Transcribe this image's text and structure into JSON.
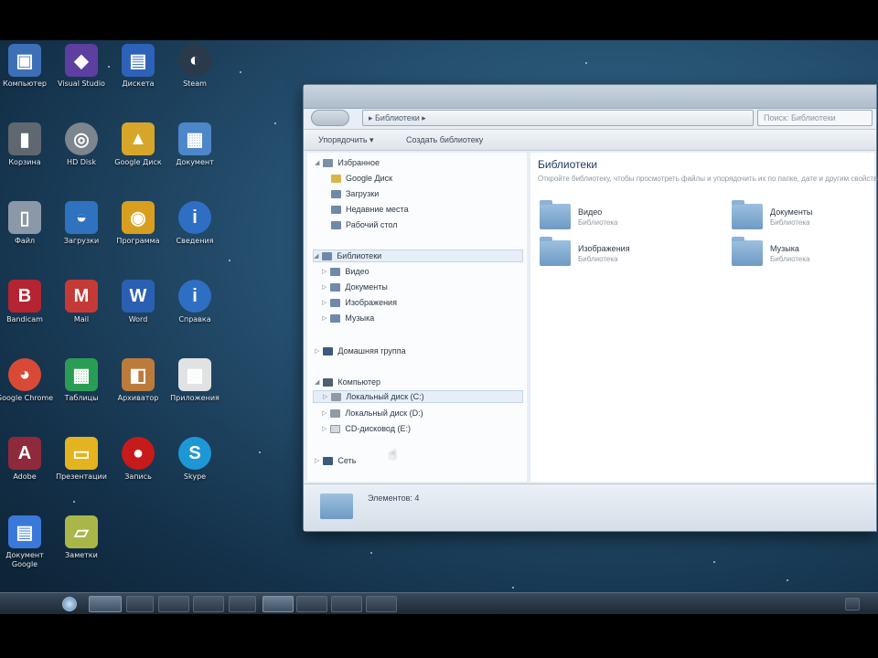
{
  "desktop": {
    "icons": [
      {
        "label": "Компьютер",
        "glyph": "▣",
        "color": "#3d6fb6"
      },
      {
        "label": "Visual Studio",
        "glyph": "◆",
        "color": "#5d3fa0"
      },
      {
        "label": "Дискета",
        "glyph": "▤",
        "color": "#2d62b8"
      },
      {
        "label": "Steam",
        "glyph": "◐",
        "color": "#2b3a4b"
      },
      {
        "label": "Корзина",
        "glyph": "▮",
        "color": "#5f6770"
      },
      {
        "label": "HD Disk",
        "glyph": "◎",
        "color": "#7d858e"
      },
      {
        "label": "Google Диск",
        "glyph": "▲",
        "color": "#d6a62a"
      },
      {
        "label": "Документ",
        "glyph": "▦",
        "color": "#4d86c9"
      },
      {
        "label": "Файл",
        "glyph": "▯",
        "color": "#8a98a8"
      },
      {
        "label": "Загрузки",
        "glyph": "◒",
        "color": "#2f73c0"
      },
      {
        "label": "Программа",
        "glyph": "◉",
        "color": "#d89f1e"
      },
      {
        "label": "Сведения",
        "glyph": "i",
        "color": "#2f6fc3"
      },
      {
        "label": "Bandicam",
        "glyph": "B",
        "color": "#b52432"
      },
      {
        "label": "Mаil",
        "glyph": "M",
        "color": "#c53a36"
      },
      {
        "label": "Word",
        "glyph": "W",
        "color": "#2b5fb2"
      },
      {
        "label": "Справка",
        "glyph": "i",
        "color": "#2f6fc3"
      },
      {
        "label": "Google Chrome",
        "glyph": "◕",
        "color": "#d84a36"
      },
      {
        "label": "Таблицы",
        "glyph": "▦",
        "color": "#2a9d55"
      },
      {
        "label": "Архиватор",
        "glyph": "◧",
        "color": "#bd7b3b"
      },
      {
        "label": "Приложения",
        "glyph": "▩",
        "color": "#e0e2e4"
      },
      {
        "label": "Adobe",
        "glyph": "A",
        "color": "#8e2a3c"
      },
      {
        "label": "Презентации",
        "glyph": "▭",
        "color": "#e3b41f"
      },
      {
        "label": "Запись",
        "glyph": "●",
        "color": "#c71a1a"
      },
      {
        "label": "Skype",
        "glyph": "S",
        "color": "#1e97d6"
      },
      {
        "label": "Документ Google",
        "glyph": "▤",
        "color": "#3a79d9"
      },
      {
        "label": "Заметки",
        "glyph": "▱",
        "color": "#a9b749"
      }
    ]
  },
  "explorer": {
    "address": "▸ Библиотеки ▸",
    "search_placeholder": "Поиск: Библиотеки",
    "toolbar": {
      "organize": "Упорядочить ▾",
      "new_library": "Создать библиотеку"
    },
    "nav": {
      "favorites": "Избранное",
      "fav_items": [
        "Google Диск",
        "Загрузки",
        "Недавние места",
        "Рабочий стол"
      ],
      "libraries": "Библиотеки",
      "lib_items": [
        "Видео",
        "Документы",
        "Изображения",
        "Музыка"
      ],
      "homegroup": "Домашняя группа",
      "computer": "Компьютер",
      "drives": [
        "Локальный диск (C:)",
        "Локальный диск (D:)",
        "CD-дисковод (E:)"
      ],
      "network": "Сеть"
    },
    "content": {
      "title": "Библиотеки",
      "description": "Откройте библиотеку, чтобы просмотреть файлы и упорядочить их по папке, дате и другим свойствам.",
      "libraries": [
        {
          "name": "Видео",
          "type": "Библиотека"
        },
        {
          "name": "Документы",
          "type": "Библиотека"
        },
        {
          "name": "Изображения",
          "type": "Библиотека"
        },
        {
          "name": "Музыка",
          "type": "Библиотека"
        }
      ]
    },
    "details": "Элементов: 4"
  },
  "taskbar": {
    "items": [
      "explorer",
      "media",
      "folder",
      "files",
      "notes",
      "desktop",
      "window",
      "folder2",
      "app"
    ]
  }
}
